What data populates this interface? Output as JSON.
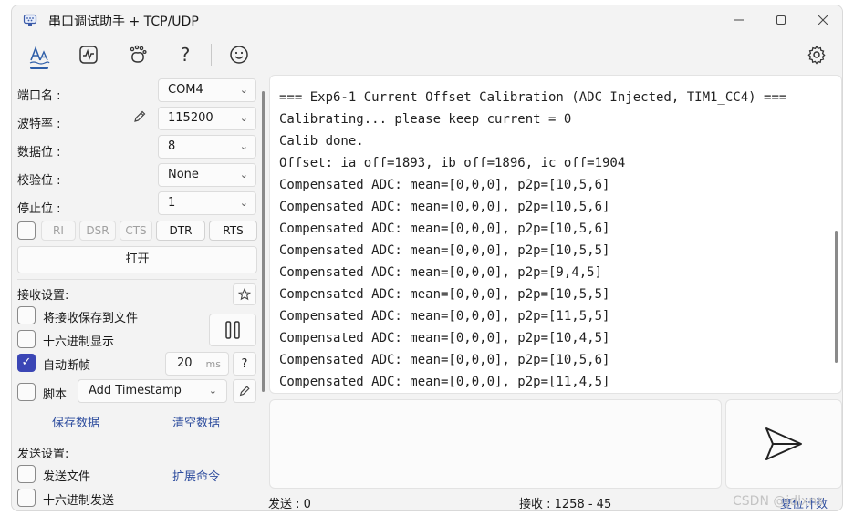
{
  "window": {
    "title": "串口调试助手 + TCP/UDP"
  },
  "toolbar": {
    "help_glyph": "?",
    "icons": [
      "font-icon",
      "waveform-icon",
      "paw-icon",
      "help-icon",
      "smiley-icon",
      "gear-icon"
    ]
  },
  "serial": {
    "port_label": "端口名 :",
    "port_value": "COM4",
    "baud_label": "波特率 :",
    "baud_value": "115200",
    "databits_label": "数据位 :",
    "databits_value": "8",
    "parity_label": "校验位 :",
    "parity_value": "None",
    "stopbits_label": "停止位 :",
    "stopbits_value": "1",
    "pins": [
      "RI",
      "DSR",
      "CTS",
      "DTR",
      "RTS"
    ],
    "open_button": "打开"
  },
  "receive_settings": {
    "title": "接收设置:",
    "save_to_file": "将接收保存到文件",
    "hex_display": "十六进制显示",
    "auto_frame": "自动断帧",
    "auto_frame_checked": true,
    "frame_value": "20",
    "frame_unit": "ms",
    "frame_help": "?",
    "script_label": "脚本",
    "script_value": "Add Timestamp",
    "save_data": "保存数据",
    "clear_data": "清空数据"
  },
  "send_settings": {
    "title": "发送设置:",
    "send_file": "发送文件",
    "extend_cmd": "扩展命令",
    "hex_send": "十六进制发送"
  },
  "receive_lines": [
    "=== Exp6-1 Current Offset Calibration (ADC Injected, TIM1_CC4) ===",
    "Calibrating... please keep current = 0",
    "Calib done.",
    "Offset: ia_off=1893, ib_off=1896, ic_off=1904",
    "Compensated ADC: mean=[0,0,0], p2p=[10,5,6]",
    "Compensated ADC: mean=[0,0,0], p2p=[10,5,6]",
    "Compensated ADC: mean=[0,0,0], p2p=[10,5,6]",
    "Compensated ADC: mean=[0,0,0], p2p=[10,5,5]",
    "Compensated ADC: mean=[0,0,0], p2p=[9,4,5]",
    "Compensated ADC: mean=[0,0,0], p2p=[10,5,5]",
    "Compensated ADC: mean=[0,0,0], p2p=[11,5,5]",
    "Compensated ADC: mean=[0,0,0], p2p=[10,4,5]",
    "Compensated ADC: mean=[0,0,0], p2p=[10,5,6]",
    "Compensated ADC: mean=[0,0,0], p2p=[11,4,5]"
  ],
  "status": {
    "sent": "发送 : 0",
    "received": "接收 : 1258  -  45",
    "reset_count": "复位计数",
    "watermark": "CSDN @jdlxns"
  },
  "colors": {
    "accent": "#3b46b5",
    "link": "#2e4d9e"
  }
}
